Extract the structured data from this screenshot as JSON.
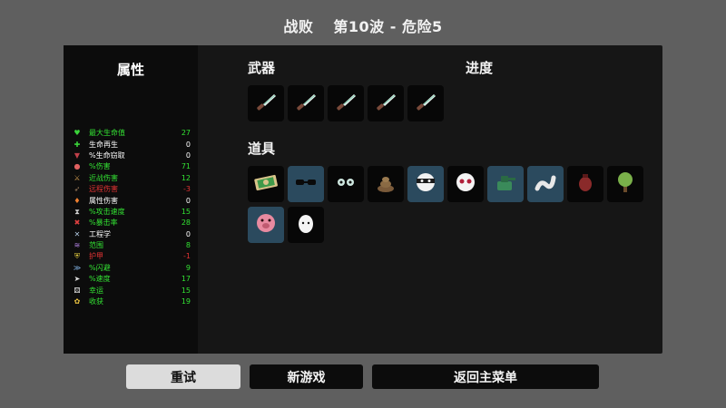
{
  "title": {
    "result": "战败",
    "wave": "第10波 - 危险5"
  },
  "stats": {
    "title": "属性",
    "items": [
      {
        "icon": "heart-icon",
        "glyph": "♥",
        "icon_color": "#3ad43a",
        "label": "最大生命值",
        "value": "27",
        "color": "#33e233"
      },
      {
        "icon": "regen-icon",
        "glyph": "✚",
        "icon_color": "#3ad43a",
        "label": "生命再生",
        "value": "0",
        "color": "#ffffff"
      },
      {
        "icon": "lifesteal-icon",
        "glyph": "▼",
        "icon_color": "#c0404a",
        "label": "%生命窃取",
        "value": "0",
        "color": "#ffffff"
      },
      {
        "icon": "damage-icon",
        "glyph": "●",
        "icon_color": "#e06060",
        "label": "%伤害",
        "value": "71",
        "color": "#33e233"
      },
      {
        "icon": "melee-icon",
        "glyph": "⚔",
        "icon_color": "#d8a050",
        "label": "近战伤害",
        "value": "12",
        "color": "#33e233"
      },
      {
        "icon": "ranged-icon",
        "glyph": "➶",
        "icon_color": "#a08060",
        "label": "远程伤害",
        "value": "-3",
        "color": "#e23333"
      },
      {
        "icon": "elemental-icon",
        "glyph": "♦",
        "icon_color": "#f08030",
        "label": "属性伤害",
        "value": "0",
        "color": "#ffffff"
      },
      {
        "icon": "attack-speed-icon",
        "glyph": "⧗",
        "icon_color": "#d0d0d0",
        "label": "%攻击速度",
        "value": "15",
        "color": "#33e233"
      },
      {
        "icon": "crit-icon",
        "glyph": "✖",
        "icon_color": "#e04040",
        "label": "%暴击率",
        "value": "28",
        "color": "#33e233"
      },
      {
        "icon": "engineering-icon",
        "glyph": "✕",
        "icon_color": "#b0c8e0",
        "label": "工程学",
        "value": "0",
        "color": "#ffffff"
      },
      {
        "icon": "range-icon",
        "glyph": "≋",
        "icon_color": "#b080e0",
        "label": "范围",
        "value": "8",
        "color": "#33e233"
      },
      {
        "icon": "armor-icon",
        "glyph": "⛨",
        "icon_color": "#e8d040",
        "label": "护甲",
        "value": "-1",
        "color": "#e23333"
      },
      {
        "icon": "dodge-icon",
        "glyph": "≫",
        "icon_color": "#80b0e0",
        "label": "%闪避",
        "value": "9",
        "color": "#33e233"
      },
      {
        "icon": "speed-icon",
        "glyph": "➤",
        "icon_color": "#e0e0e0",
        "label": "%速度",
        "value": "17",
        "color": "#33e233"
      },
      {
        "icon": "luck-icon",
        "glyph": "⚄",
        "icon_color": "#f0f0f0",
        "label": "幸运",
        "value": "15",
        "color": "#33e233"
      },
      {
        "icon": "harvest-icon",
        "glyph": "✿",
        "icon_color": "#e8c040",
        "label": "收获",
        "value": "19",
        "color": "#33e233"
      }
    ]
  },
  "weapons": {
    "title": "武器",
    "items": [
      {
        "icon": "knife-icon"
      },
      {
        "icon": "knife-icon"
      },
      {
        "icon": "knife-icon"
      },
      {
        "icon": "knife-icon"
      },
      {
        "icon": "knife-icon"
      }
    ]
  },
  "progress": {
    "title": "进度"
  },
  "items": {
    "title": "道具",
    "list": [
      {
        "icon": "cash-icon",
        "highlight": false
      },
      {
        "icon": "glasses-icon",
        "highlight": true
      },
      {
        "icon": "alien-eyes-icon",
        "highlight": false
      },
      {
        "icon": "poop-icon",
        "highlight": false
      },
      {
        "icon": "bandit-mask-icon",
        "highlight": true
      },
      {
        "icon": "ghost-face-icon",
        "highlight": false
      },
      {
        "icon": "turret-icon",
        "highlight": true
      },
      {
        "icon": "worm-icon",
        "highlight": true
      },
      {
        "icon": "grenade-icon",
        "highlight": false
      },
      {
        "icon": "tree-icon",
        "highlight": false
      },
      {
        "icon": "pig-icon",
        "highlight": true
      },
      {
        "icon": "egg-icon",
        "highlight": false
      }
    ]
  },
  "buttons": {
    "retry": "重试",
    "new_game": "新游戏",
    "main_menu": "返回主菜单"
  },
  "colors": {
    "background": "#5f5f5f",
    "panel": "#161616",
    "slot_highlight": "#2b4a5e",
    "positive": "#33e233",
    "negative": "#e23333"
  }
}
